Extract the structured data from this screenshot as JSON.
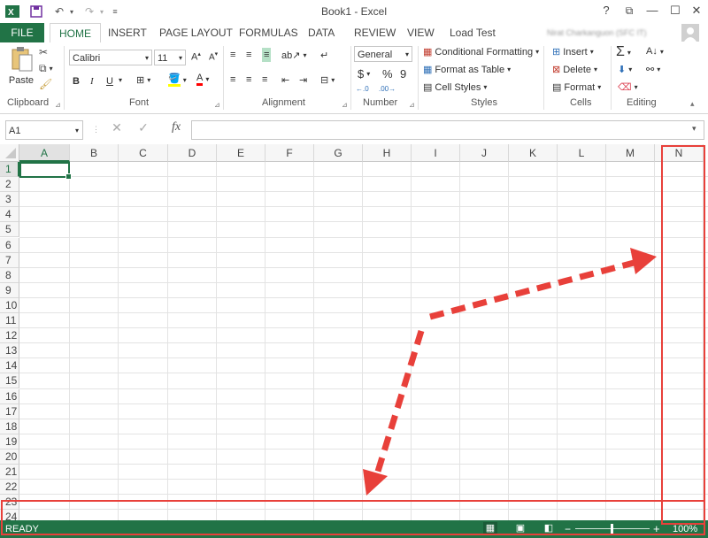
{
  "window": {
    "title": "Book1 - Excel",
    "user": "Nirat Charkanguon (SFC IT)",
    "controls": [
      "?",
      "⧉",
      "—",
      "☐",
      "✕"
    ]
  },
  "ribbon_tabs": [
    "FILE",
    "HOME",
    "INSERT",
    "PAGE LAYOUT",
    "FORMULAS",
    "DATA",
    "REVIEW",
    "VIEW",
    "Load Test"
  ],
  "clipboard": {
    "paste": "Paste",
    "label": "Clipboard"
  },
  "font": {
    "name": "Calibri",
    "size": "11",
    "label": "Font",
    "bold": "B",
    "italic": "I",
    "underline": "U"
  },
  "alignment": {
    "label": "Alignment"
  },
  "number": {
    "format": "General",
    "label": "Number",
    "currency": "$",
    "percent": "%",
    "comma": "9"
  },
  "styles": {
    "conditional": "Conditional Formatting",
    "format_table": "Format as Table",
    "cell_styles": "Cell Styles",
    "label": "Styles"
  },
  "cells": {
    "insert": "Insert",
    "delete": "Delete",
    "format": "Format",
    "label": "Cells"
  },
  "editing": {
    "label": "Editing"
  },
  "formula_bar": {
    "name_box": "A1",
    "fx": "fx",
    "value": ""
  },
  "columns": [
    "A",
    "B",
    "C",
    "D",
    "E",
    "F",
    "G",
    "H",
    "I",
    "J",
    "K",
    "L",
    "M",
    "N"
  ],
  "rows": [
    "1",
    "2",
    "3",
    "4",
    "5",
    "6",
    "7",
    "8",
    "9",
    "10",
    "11",
    "12",
    "13",
    "14",
    "15",
    "16",
    "17",
    "18",
    "19",
    "20",
    "21",
    "22",
    "23",
    "24"
  ],
  "selected_cell": "A1",
  "status": {
    "ready": "READY",
    "zoom": "100%",
    "zoom_minus": "−",
    "zoom_plus": "+"
  },
  "annotation_color": "#e8403a"
}
